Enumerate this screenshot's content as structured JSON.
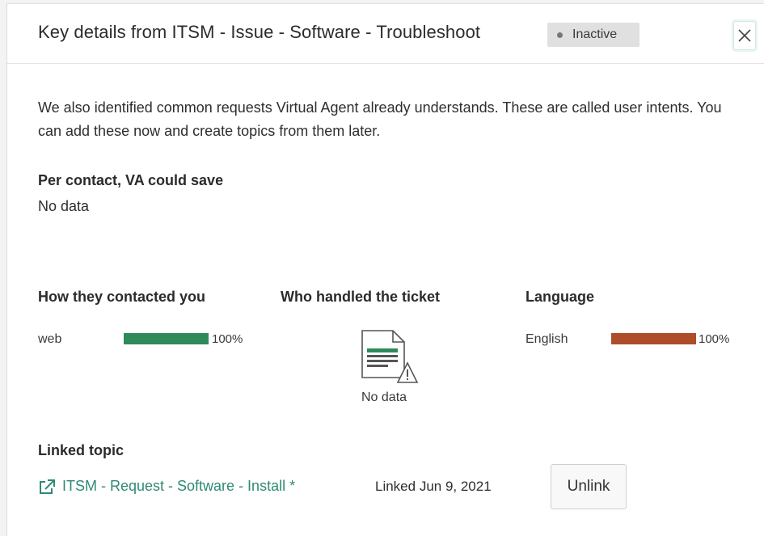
{
  "header": {
    "title": "Key details from ITSM - Issue - Software - Troubleshoot",
    "status_badge": "Inactive",
    "close_icon": "close-icon"
  },
  "intro": {
    "text": "We also identified common requests Virtual Agent already understands. These are called user intents. You can add these now and create topics from them later."
  },
  "savings": {
    "label": "Per contact, VA could save",
    "value": "No data"
  },
  "contacted": {
    "heading": "How they contacted you",
    "items": [
      {
        "label": "web",
        "percent_text": "100%",
        "fraction": 1.0
      }
    ]
  },
  "handled": {
    "heading": "Who handled the ticket",
    "icon": "document-warning-icon",
    "value": "No data"
  },
  "language": {
    "heading": "Language",
    "items": [
      {
        "label": "English",
        "percent_text": "100%",
        "fraction": 1.0
      }
    ]
  },
  "linked_topic": {
    "heading": "Linked topic",
    "link_icon": "external-link-icon",
    "link_text": "ITSM - Request - Software - Install *",
    "linked_date": "Linked Jun 9, 2021",
    "unlink_label": "Unlink"
  },
  "colors": {
    "accent": "#2e8a74",
    "contact_bar": "#2f8a5a",
    "language_bar": "#ad4d2a",
    "badge_bg": "#e0e0e0"
  }
}
